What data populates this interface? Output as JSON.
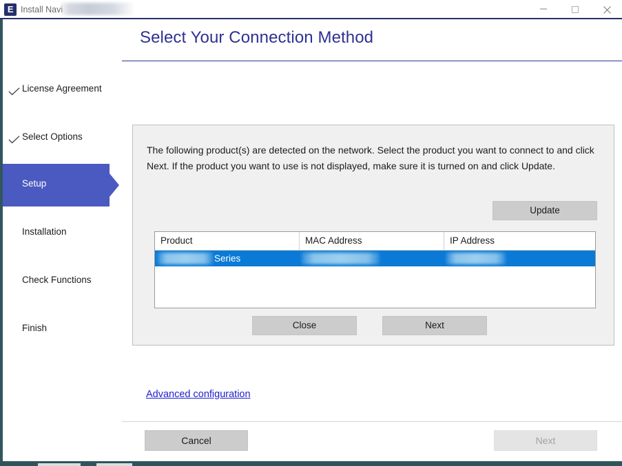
{
  "window": {
    "app_icon": "epson-e-icon",
    "title": "Install Navi",
    "title_redacted": true,
    "controls": {
      "minimize": "minimize-icon",
      "maximize": "maximize-icon",
      "close": "close-icon"
    }
  },
  "header": {
    "title": "Select Your Connection Method"
  },
  "sidebar": {
    "items": [
      {
        "label": "License Agreement",
        "state": "completed",
        "icon": "check-icon"
      },
      {
        "label": "Select Options",
        "state": "completed",
        "icon": "check-icon"
      },
      {
        "label": "Setup",
        "state": "active",
        "icon": ""
      },
      {
        "label": "Installation",
        "state": "pending",
        "icon": ""
      },
      {
        "label": "Check Functions",
        "state": "pending",
        "icon": ""
      },
      {
        "label": "Finish",
        "state": "pending",
        "icon": ""
      }
    ]
  },
  "panel": {
    "description": "The following product(s) are detected on the network. Select the product you want to connect to and click Next. If the product you want to use is not displayed, make sure it is turned on and click Update.",
    "update_label": "Update",
    "table": {
      "columns": [
        "Product",
        "MAC Address",
        "IP Address"
      ],
      "rows": [
        {
          "product": "Series",
          "product_prefix_redacted": true,
          "mac_address": "",
          "mac_address_redacted": true,
          "ip_address": "",
          "ip_address_redacted": true,
          "selected": true
        }
      ]
    },
    "close_label": "Close",
    "next_label": "Next"
  },
  "links": {
    "advanced_configuration": "Advanced configuration"
  },
  "footer": {
    "cancel_label": "Cancel",
    "next_label": "Next",
    "next_enabled": false
  },
  "colors": {
    "accent_blue": "#2e3192",
    "active_step": "#4a5ac0",
    "selection_blue": "#0a7ad6",
    "link_blue": "#2020d0",
    "button_gray": "#cccccc",
    "panel_gray": "#f0f0f0",
    "frame_teal": "#31565e"
  }
}
